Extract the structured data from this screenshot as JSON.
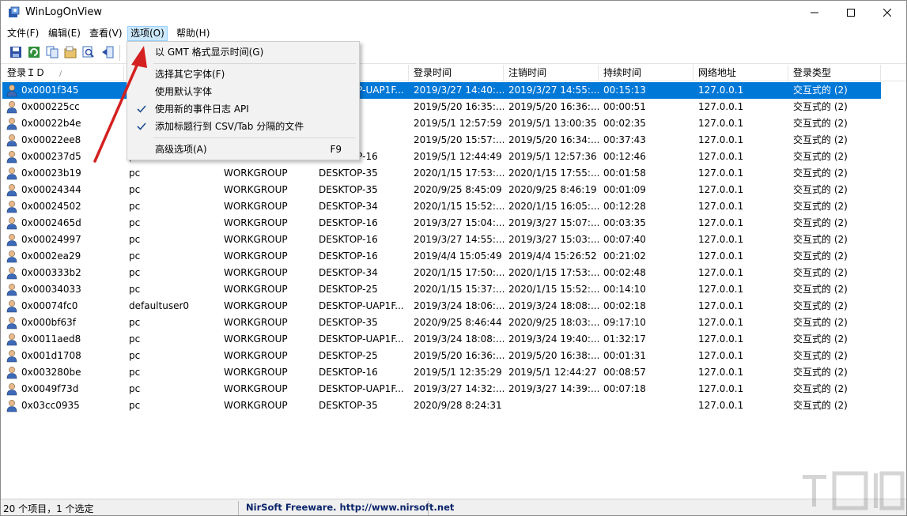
{
  "window": {
    "title": "WinLogOnView"
  },
  "menubar": {
    "items": [
      {
        "label": "文件(F)"
      },
      {
        "label": "编辑(E)"
      },
      {
        "label": "查看(V)"
      },
      {
        "label": "选项(O)"
      },
      {
        "label": "帮助(H)"
      }
    ]
  },
  "options_menu": {
    "items": [
      {
        "label": "以 GMT 格式显示时间(G)",
        "checked": false,
        "shortcut": ""
      },
      {
        "label": "选择其它字体(F)",
        "checked": false,
        "shortcut": ""
      },
      {
        "label": "使用默认字体",
        "checked": false,
        "shortcut": ""
      },
      {
        "label": "使用新的事件日志 API",
        "checked": true,
        "shortcut": ""
      },
      {
        "label": "添加标题行到 CSV/Tab 分隔的文件",
        "checked": true,
        "shortcut": ""
      },
      {
        "label": "高级选项(A)",
        "checked": false,
        "shortcut": "F9"
      }
    ]
  },
  "table": {
    "columns": [
      "登录ＩＤ",
      "",
      "",
      "",
      "登录时间",
      "注销时间",
      "持续时间",
      "网络地址",
      "登录类型"
    ],
    "rows": [
      {
        "id": "0x0001f345",
        "user": "",
        "domain": "",
        "computer": "DESKTOP-UAP1F...",
        "logon": "2019/3/27 14:40:...",
        "logoff": "2019/3/27 14:55:...",
        "duration": "00:15:13",
        "address": "127.0.0.1",
        "type": "交互式的 (2)",
        "selected": true
      },
      {
        "id": "0x000225cc",
        "user": "",
        "domain": "",
        "computer": "-25",
        "logon": "2019/5/20 16:35:...",
        "logoff": "2019/5/20 16:36:...",
        "duration": "00:00:51",
        "address": "127.0.0.1",
        "type": "交互式的 (2)"
      },
      {
        "id": "0x00022b4e",
        "user": "",
        "domain": "",
        "computer": "-25",
        "logon": "2019/5/1 12:57:59",
        "logoff": "2019/5/1 13:00:35",
        "duration": "00:02:35",
        "address": "127.0.0.1",
        "type": "交互式的 (2)"
      },
      {
        "id": "0x00022ee8",
        "user": "",
        "domain": "",
        "computer": "-25",
        "logon": "2019/5/20 15:57:...",
        "logoff": "2019/5/20 16:34:...",
        "duration": "00:37:43",
        "address": "127.0.0.1",
        "type": "交互式的 (2)"
      },
      {
        "id": "0x000237d5",
        "user": "pc",
        "domain": "",
        "computer": "DESKTOP-16",
        "logon": "2019/5/1 12:44:49",
        "logoff": "2019/5/1 12:57:36",
        "duration": "00:12:46",
        "address": "127.0.0.1",
        "type": "交互式的 (2)"
      },
      {
        "id": "0x00023b19",
        "user": "pc",
        "domain": "WORKGROUP",
        "computer": "DESKTOP-35",
        "logon": "2020/1/15 17:53:...",
        "logoff": "2020/1/15 17:55:...",
        "duration": "00:01:58",
        "address": "127.0.0.1",
        "type": "交互式的 (2)"
      },
      {
        "id": "0x00024344",
        "user": "pc",
        "domain": "WORKGROUP",
        "computer": "DESKTOP-35",
        "logon": "2020/9/25 8:45:09",
        "logoff": "2020/9/25 8:46:19",
        "duration": "00:01:09",
        "address": "127.0.0.1",
        "type": "交互式的 (2)"
      },
      {
        "id": "0x00024502",
        "user": "pc",
        "domain": "WORKGROUP",
        "computer": "DESKTOP-34",
        "logon": "2020/1/15 15:52:...",
        "logoff": "2020/1/15 16:05:...",
        "duration": "00:12:28",
        "address": "127.0.0.1",
        "type": "交互式的 (2)"
      },
      {
        "id": "0x0002465d",
        "user": "pc",
        "domain": "WORKGROUP",
        "computer": "DESKTOP-16",
        "logon": "2019/3/27 15:04:...",
        "logoff": "2019/3/27 15:07:...",
        "duration": "00:03:35",
        "address": "127.0.0.1",
        "type": "交互式的 (2)"
      },
      {
        "id": "0x00024997",
        "user": "pc",
        "domain": "WORKGROUP",
        "computer": "DESKTOP-16",
        "logon": "2019/3/27 14:55:...",
        "logoff": "2019/3/27 15:03:...",
        "duration": "00:07:40",
        "address": "127.0.0.1",
        "type": "交互式的 (2)"
      },
      {
        "id": "0x0002ea29",
        "user": "pc",
        "domain": "WORKGROUP",
        "computer": "DESKTOP-16",
        "logon": "2019/4/4 15:05:49",
        "logoff": "2019/4/4 15:26:52",
        "duration": "00:21:02",
        "address": "127.0.0.1",
        "type": "交互式的 (2)"
      },
      {
        "id": "0x000333b2",
        "user": "pc",
        "domain": "WORKGROUP",
        "computer": "DESKTOP-34",
        "logon": "2020/1/15 17:50:...",
        "logoff": "2020/1/15 17:53:...",
        "duration": "00:02:48",
        "address": "127.0.0.1",
        "type": "交互式的 (2)"
      },
      {
        "id": "0x00034033",
        "user": "pc",
        "domain": "WORKGROUP",
        "computer": "DESKTOP-25",
        "logon": "2020/1/15 15:37:...",
        "logoff": "2020/1/15 15:52:...",
        "duration": "00:14:10",
        "address": "127.0.0.1",
        "type": "交互式的 (2)"
      },
      {
        "id": "0x00074fc0",
        "user": "defaultuser0",
        "domain": "WORKGROUP",
        "computer": "DESKTOP-UAP1F...",
        "logon": "2019/3/24 18:06:...",
        "logoff": "2019/3/24 18:08:...",
        "duration": "00:02:18",
        "address": "127.0.0.1",
        "type": "交互式的 (2)"
      },
      {
        "id": "0x000bf63f",
        "user": "pc",
        "domain": "WORKGROUP",
        "computer": "DESKTOP-35",
        "logon": "2020/9/25 8:46:44",
        "logoff": "2020/9/25 18:03:...",
        "duration": "09:17:10",
        "address": "127.0.0.1",
        "type": "交互式的 (2)"
      },
      {
        "id": "0x0011aed8",
        "user": "pc",
        "domain": "WORKGROUP",
        "computer": "DESKTOP-UAP1F...",
        "logon": "2019/3/24 18:08:...",
        "logoff": "2019/3/24 19:40:...",
        "duration": "01:32:17",
        "address": "127.0.0.1",
        "type": "交互式的 (2)"
      },
      {
        "id": "0x001d1708",
        "user": "pc",
        "domain": "WORKGROUP",
        "computer": "DESKTOP-25",
        "logon": "2019/5/20 16:36:...",
        "logoff": "2019/5/20 16:38:...",
        "duration": "00:01:31",
        "address": "127.0.0.1",
        "type": "交互式的 (2)"
      },
      {
        "id": "0x003280be",
        "user": "pc",
        "domain": "WORKGROUP",
        "computer": "DESKTOP-16",
        "logon": "2019/5/1 12:35:29",
        "logoff": "2019/5/1 12:44:27",
        "duration": "00:08:57",
        "address": "127.0.0.1",
        "type": "交互式的 (2)"
      },
      {
        "id": "0x0049f73d",
        "user": "pc",
        "domain": "WORKGROUP",
        "computer": "DESKTOP-UAP1F...",
        "logon": "2019/3/27 14:32:...",
        "logoff": "2019/3/27 14:39:...",
        "duration": "00:07:18",
        "address": "127.0.0.1",
        "type": "交互式的 (2)"
      },
      {
        "id": "0x03cc0935",
        "user": "pc",
        "domain": "WORKGROUP",
        "computer": "DESKTOP-35",
        "logon": "2020/9/28 8:24:31",
        "logoff": "",
        "duration": "",
        "address": "127.0.0.1",
        "type": "交互式的 (2)"
      }
    ]
  },
  "statusbar": {
    "count": "20 个项目，1 个选定",
    "credit": "NirSoft Freeware.  http://www.nirsoft.net"
  },
  "colors": {
    "selection": "#0078d7",
    "menu_highlight": "#cce8ff",
    "annotation": "#d42020"
  }
}
